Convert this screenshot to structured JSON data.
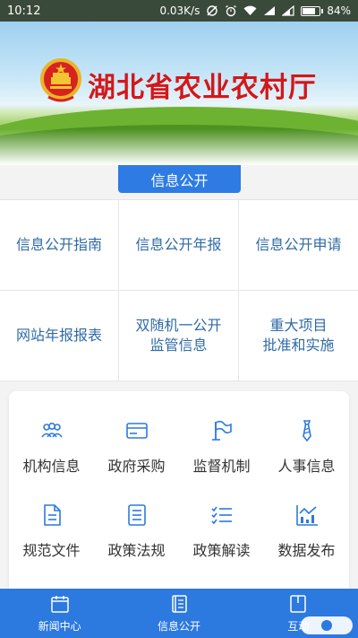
{
  "status_bar": {
    "time": "10:12",
    "network_speed": "0.03K/s",
    "battery": "84%",
    "battery_level": 0.84,
    "icons": [
      "alarm-off-icon",
      "alarm-icon",
      "wifi-icon",
      "signal-icon",
      "signal-icon-2",
      "battery-icon"
    ]
  },
  "banner": {
    "title": "湖北省农业农村厅",
    "emblem": "national-emblem"
  },
  "section_tab": {
    "label": "信息公开"
  },
  "grid": {
    "cells": [
      {
        "label": "信息公开指南"
      },
      {
        "label": "信息公开年报"
      },
      {
        "label": "信息公开申请"
      },
      {
        "label": "网站年报报表"
      },
      {
        "label": "双随机一公开\n监管信息"
      },
      {
        "label": "重大项目\n批准和实施"
      }
    ]
  },
  "panel": {
    "items": [
      {
        "label": "机构信息",
        "icon": "people-icon"
      },
      {
        "label": "政府采购",
        "icon": "card-icon"
      },
      {
        "label": "监督机制",
        "icon": "flag-icon"
      },
      {
        "label": "人事信息",
        "icon": "tie-icon"
      },
      {
        "label": "规范文件",
        "icon": "document-icon"
      },
      {
        "label": "政策法规",
        "icon": "list-doc-icon"
      },
      {
        "label": "政策解读",
        "icon": "checklist-icon"
      },
      {
        "label": "数据发布",
        "icon": "bar-chart-icon"
      }
    ]
  },
  "bottom_nav": {
    "items": [
      {
        "label": "新闻中心",
        "icon": "calendar-icon"
      },
      {
        "label": "信息公开",
        "icon": "book-icon"
      },
      {
        "label": "互动",
        "icon": "notebook-icon"
      }
    ]
  },
  "colors": {
    "primary": "#2c79e0",
    "title_red": "#d1181b",
    "grid_text": "#2f6aa6"
  }
}
